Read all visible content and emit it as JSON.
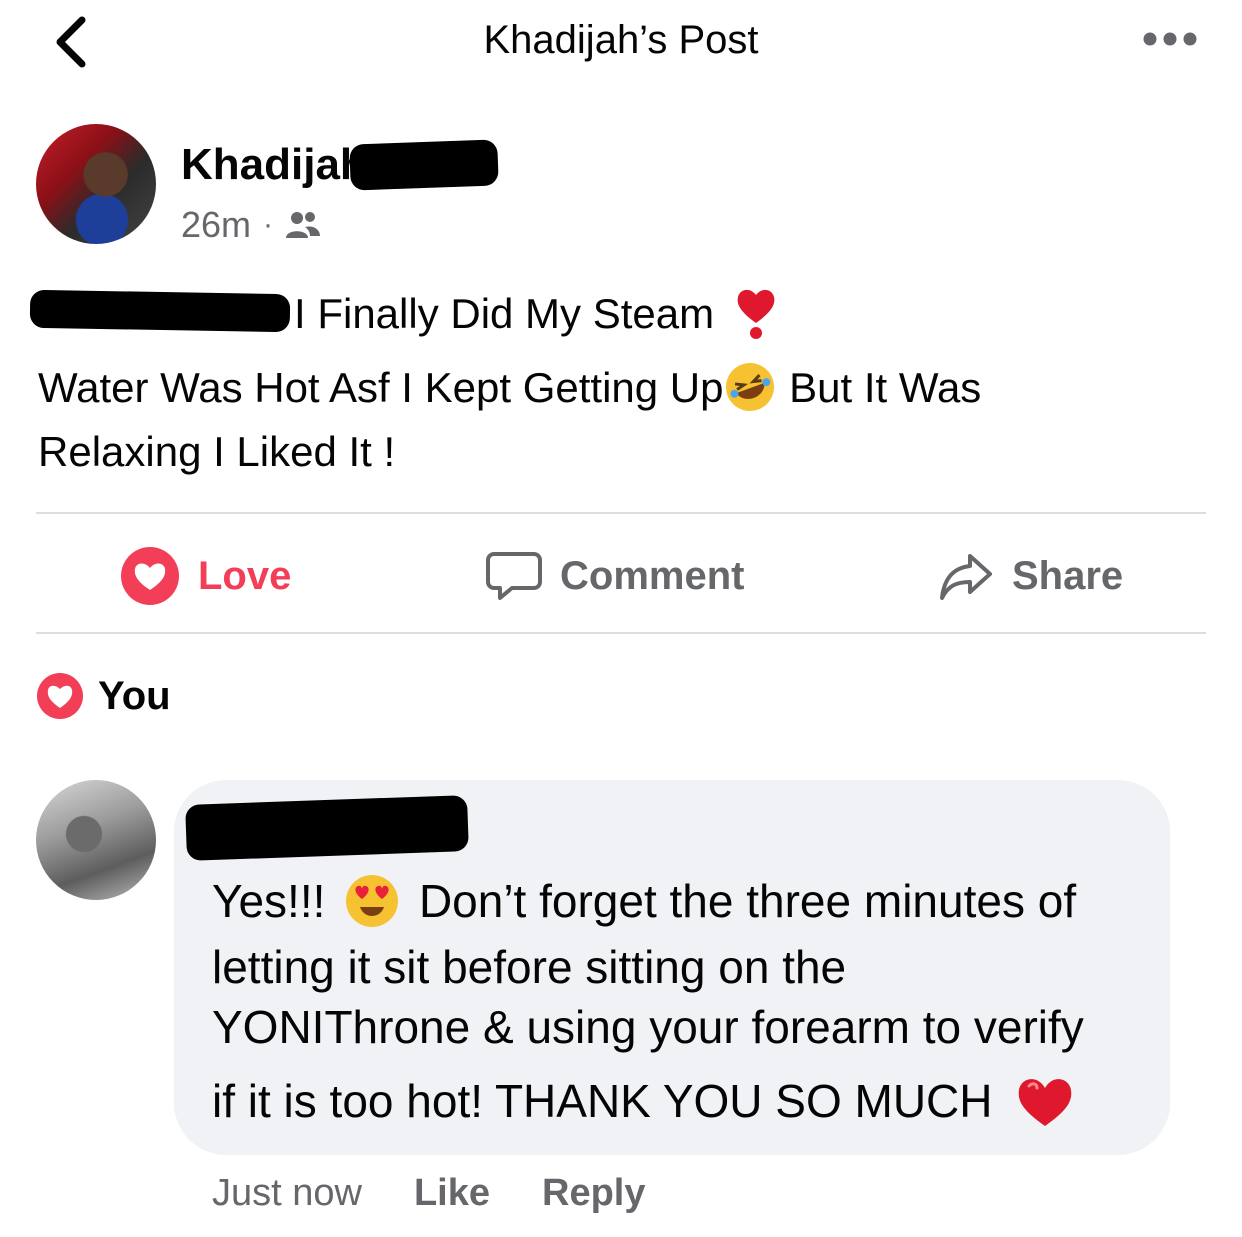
{
  "header": {
    "title": "Khadijah’s Post"
  },
  "post": {
    "author_name": "Khadijah",
    "timestamp": "26m",
    "meta_separator": "·",
    "audience_icon": "friends-icon",
    "line1": "I Finally Did My Steam",
    "line1_emoji": "❣️",
    "line2a": "Water Was Hot Asf I Kept Getting Up",
    "line2_emoji": "🤣",
    "line2b": " But It Was",
    "line3": "Relaxing I Liked It !"
  },
  "actions": {
    "love_label": "Love",
    "comment_label": "Comment",
    "share_label": "Share",
    "love_color": "#f33e58",
    "muted_color": "#65676b"
  },
  "reactions": {
    "reactor": "You",
    "icon": "love-reaction-icon"
  },
  "comment": {
    "line1a": "Yes!!!",
    "line1_emoji": "😍",
    "line1b": "Don’t forget the three minutes of",
    "line2": "letting it sit before sitting on the",
    "line3": "YONIThrone & using your forearm to verify",
    "line4": "if it is too hot! THANK YOU SO MUCH",
    "line4_emoji": "❤️",
    "time": "Just now",
    "like_label": "Like",
    "reply_label": "Reply"
  }
}
